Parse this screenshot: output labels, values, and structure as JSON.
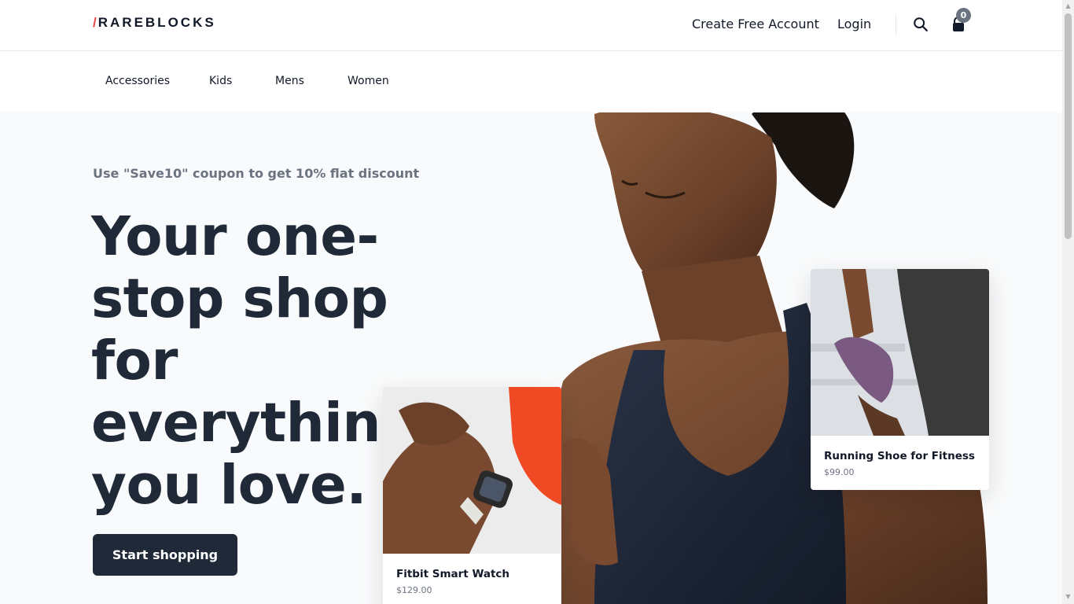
{
  "brand": {
    "slash": "/",
    "name": "RAREBLOCKS"
  },
  "header": {
    "create_account": "Create Free Account",
    "login": "Login",
    "cart_count": "0"
  },
  "nav": [
    "Accessories",
    "Kids",
    "Mens",
    "Women"
  ],
  "hero": {
    "coupon_text": "Use \"Save10\" coupon to get 10% flat discount",
    "headline": "Your one-stop shop for everything you love.",
    "cta_label": "Start shopping"
  },
  "products": [
    {
      "title": "Fitbit Smart Watch",
      "price": "$129.00"
    },
    {
      "title": "Running Shoe for Fitness",
      "price": "$99.00"
    }
  ],
  "colors": {
    "accent": "#ef4444",
    "dark": "#1f2937",
    "muted": "#6b7280",
    "hero_bg": "#f9fafb"
  }
}
